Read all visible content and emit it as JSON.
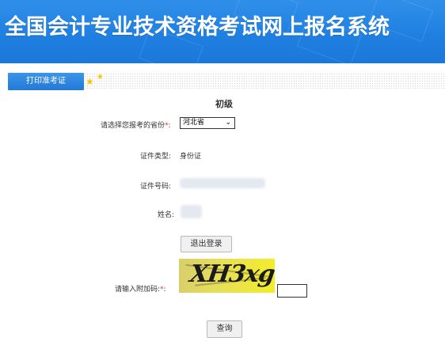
{
  "header": {
    "title": "全国会计专业技术资格考试网上报名系统"
  },
  "nav": {
    "tab_label": "打印准考证"
  },
  "form": {
    "level": "初级",
    "province_label": "请选择您报考的省份",
    "province_required": "*",
    "province_colon": ":",
    "province_value": "河北省",
    "id_type_label": "证件类型:",
    "id_type_value": "身份证",
    "id_number_label": "证件号码:",
    "name_label": "姓名:",
    "logout_button": "退出登录",
    "captcha_label": "请输入附加码:",
    "captcha_required": "*",
    "captcha_colon": ":",
    "captcha_image_text": "XH3xg",
    "captcha_input_value": "",
    "query_button": "查询"
  }
}
